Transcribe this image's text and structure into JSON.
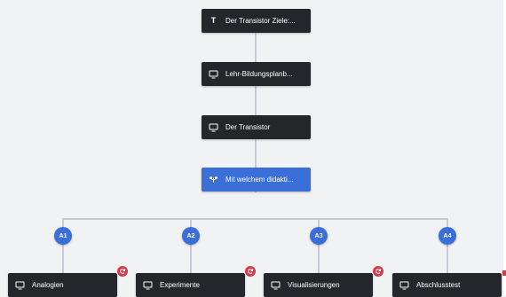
{
  "nodes": {
    "goals": {
      "label": "Der Transistor Ziele:...",
      "icon": "text-t-icon"
    },
    "curriculum": {
      "label": "Lehr-Bildungsplanb...",
      "icon": "monitor-icon"
    },
    "transistor": {
      "label": "Der Transistor",
      "icon": "monitor-icon"
    },
    "question": {
      "label": "Mit welchem didakti...",
      "icon": "branch-icon"
    }
  },
  "answers": [
    {
      "id": "A1",
      "label": "Analogien",
      "icon": "monitor-icon",
      "badge": "cycle-icon"
    },
    {
      "id": "A2",
      "label": "Experimente",
      "icon": "monitor-icon",
      "badge": "cycle-icon"
    },
    {
      "id": "A3",
      "label": "Visualisierungen",
      "icon": "monitor-icon",
      "badge": "cycle-icon"
    },
    {
      "id": "A4",
      "label": "Abschlusstest",
      "icon": "monitor-icon",
      "badge": null
    }
  ],
  "colors": {
    "node_dark": "#24262b",
    "node_question": "#3a6fd8",
    "answer_circle": "#3a6fd8",
    "badge": "#d23b4a",
    "connector": "#c7cad2",
    "background": "#f1f2f4"
  }
}
